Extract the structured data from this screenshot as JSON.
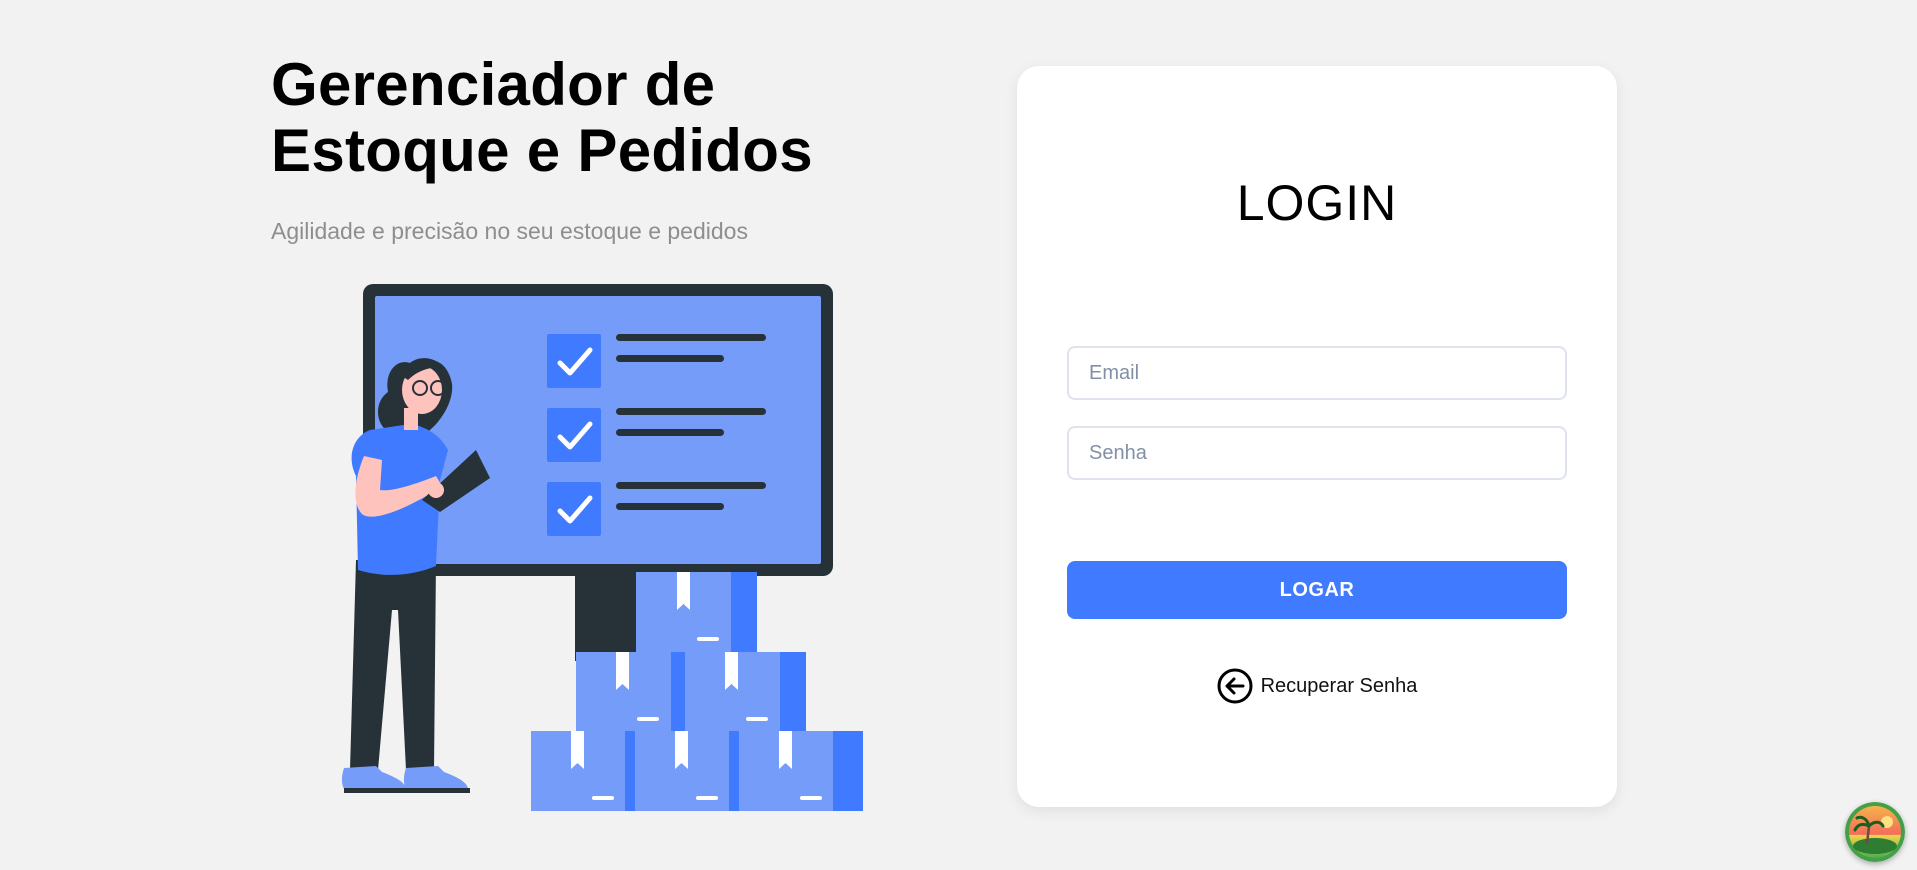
{
  "hero": {
    "title_line1": "Gerenciador de",
    "title_line2": "Estoque e Pedidos",
    "subtitle": "Agilidade e precisão no seu estoque e pedidos",
    "illustration_icon": "person-inventory-checklist-illustration"
  },
  "login": {
    "title": "LOGIN",
    "email_placeholder": "Email",
    "email_value": "",
    "password_placeholder": "Senha",
    "password_value": "",
    "submit_label": "LOGAR",
    "recover_label": "Recuperar Senha",
    "recover_icon": "arrow-left-circle-icon"
  },
  "colors": {
    "background": "#f2f2f2",
    "accent": "#407bff",
    "card": "#ffffff",
    "subtitle": "#8e8e8e"
  },
  "corner_widget_icon": "tropical-island-avatar-icon"
}
